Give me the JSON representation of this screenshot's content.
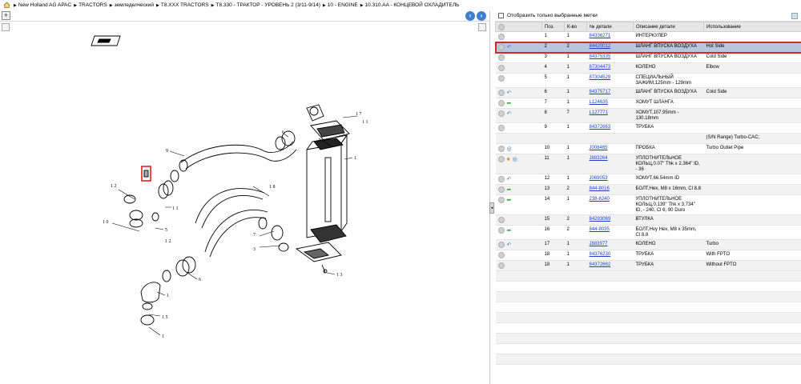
{
  "breadcrumb": [
    "New Holland AG APAC",
    "TRACTORS",
    "земледелческий",
    "T8.XXX TRACTORS",
    "T8.330 - ТРАКТОР - УРОВЕНЬ 2 (3/11-9/14)",
    "10 - ENGINE",
    "10.310.AA - КОНЦЕВОЙ ОХЛАДИТЕЛЬ"
  ],
  "filter_label": "Отобразить только выбранные метки",
  "columns": [
    "",
    "Поз.",
    "К-во",
    "№ детали",
    "Описание детали",
    "Использование"
  ],
  "colors": {
    "accent": "#3f7fd0",
    "link": "#1a3fd0",
    "selected_row": "#b9c7de",
    "selected_outline": "#d9262c"
  },
  "rows": [
    {
      "pos": "1",
      "qty": "1",
      "part": "84336271",
      "desc": "ИНТЕРКУЛЕР",
      "usage": "",
      "icons": []
    },
    {
      "pos": "2",
      "qty": "2",
      "part": "84420012",
      "desc": "ШЛАНГ ВПУСКА ВОЗДУХА",
      "usage": "Hot Side",
      "icons": [
        "return-arrow-icon"
      ]
    },
    {
      "pos": "3",
      "qty": "1",
      "part": "84375335",
      "desc": "ШЛАНГ ВПУСКА ВОЗДУХА",
      "usage": "Cold Side",
      "icons": []
    },
    {
      "pos": "4",
      "qty": "1",
      "part": "87304473",
      "desc": "КОЛЕНО",
      "usage": "Elbow",
      "icons": []
    },
    {
      "pos": "5",
      "qty": "1",
      "part": "87304529",
      "desc": "СПЕЦИАЛЬНЫЙ ЗАЖИМ,125mm - 129mm",
      "usage": "",
      "icons": []
    },
    {
      "pos": "6",
      "qty": "1",
      "part": "84375717",
      "desc": "ШЛАНГ ВПУСКА ВОЗДУХА",
      "usage": "Cold Side",
      "icons": [
        "return-arrow-icon"
      ]
    },
    {
      "pos": "7",
      "qty": "1",
      "part": "L124635",
      "desc": "ХОМУТ ШЛАНГА",
      "usage": "",
      "icons": [
        "green-arrow-icon"
      ]
    },
    {
      "pos": "8",
      "qty": "7",
      "part": "L127771",
      "desc": "ХОМУТ,107.95mm - 130.18mm",
      "usage": "",
      "icons": [
        "return-arrow-icon"
      ]
    },
    {
      "pos": "9",
      "qty": "1",
      "part": "84372663",
      "desc": "ТРУБКА",
      "usage": "",
      "icons": []
    },
    {
      "pos": "",
      "qty": "",
      "part": "",
      "desc": "",
      "usage": "(S/N Range) Turbo-CAC;",
      "icons": [],
      "noCircle": true
    },
    {
      "pos": "10",
      "qty": "1",
      "part": "J008465",
      "desc": "ПРОБКА",
      "usage": "Turbo Outlet Pipe",
      "icons": [
        "globe-icon"
      ]
    },
    {
      "pos": "11",
      "qty": "1",
      "part": "J883264",
      "desc": "УПЛОТНИТЕЛЬНОЕ КОЛЬЦ,0.07\" Thk x 2.364\" ID, - 36",
      "usage": "",
      "icons": [
        "package-icon",
        "globe-icon"
      ]
    },
    {
      "pos": "12",
      "qty": "1",
      "part": "J069053",
      "desc": "ХОМУТ,66.54mm ID",
      "usage": "",
      "icons": [
        "return-arrow-icon"
      ]
    },
    {
      "pos": "13",
      "qty": "2",
      "part": "844-8016",
      "desc": "БОЛТ,Hex, M8 x 16mm, Cl 8.8",
      "usage": "",
      "icons": [
        "green-arrow-icon"
      ]
    },
    {
      "pos": "14",
      "qty": "1",
      "part": "238-6240",
      "desc": "УПЛОТНИТЕЛЬНОЕ КОЛЬЦ,0.139\" Thk x 3.734\" ID, - 240, Cl 6, 90 Duro",
      "usage": "",
      "icons": [
        "green-arrow-icon"
      ]
    },
    {
      "pos": "15",
      "qty": "2",
      "part": "84293069",
      "desc": "ВТУЛКА",
      "usage": "",
      "icons": []
    },
    {
      "pos": "16",
      "qty": "2",
      "part": "844-8035",
      "desc": "БОЛТ,Hvy Hex, M8 x 35mm, Cl 8.8",
      "usage": "",
      "icons": [
        "green-arrow-icon"
      ]
    },
    {
      "pos": "17",
      "qty": "1",
      "part": "J883977",
      "desc": "КОЛЕНО",
      "usage": "Turbo",
      "icons": [
        "return-arrow-icon"
      ]
    },
    {
      "pos": "18",
      "qty": "1",
      "part": "84376230",
      "desc": "ТРУБКА",
      "usage": "With FPTO",
      "icons": []
    },
    {
      "pos": "18",
      "qty": "1",
      "part": "84372662",
      "desc": "ТРУБКА",
      "usage": "Without FPTO",
      "icons": []
    }
  ],
  "diagram_callouts": [
    "1",
    "2",
    "3",
    "4",
    "5",
    "6",
    "7",
    "8",
    "9",
    "10",
    "11",
    "12",
    "13",
    "14",
    "15",
    "16",
    "17",
    "18"
  ]
}
